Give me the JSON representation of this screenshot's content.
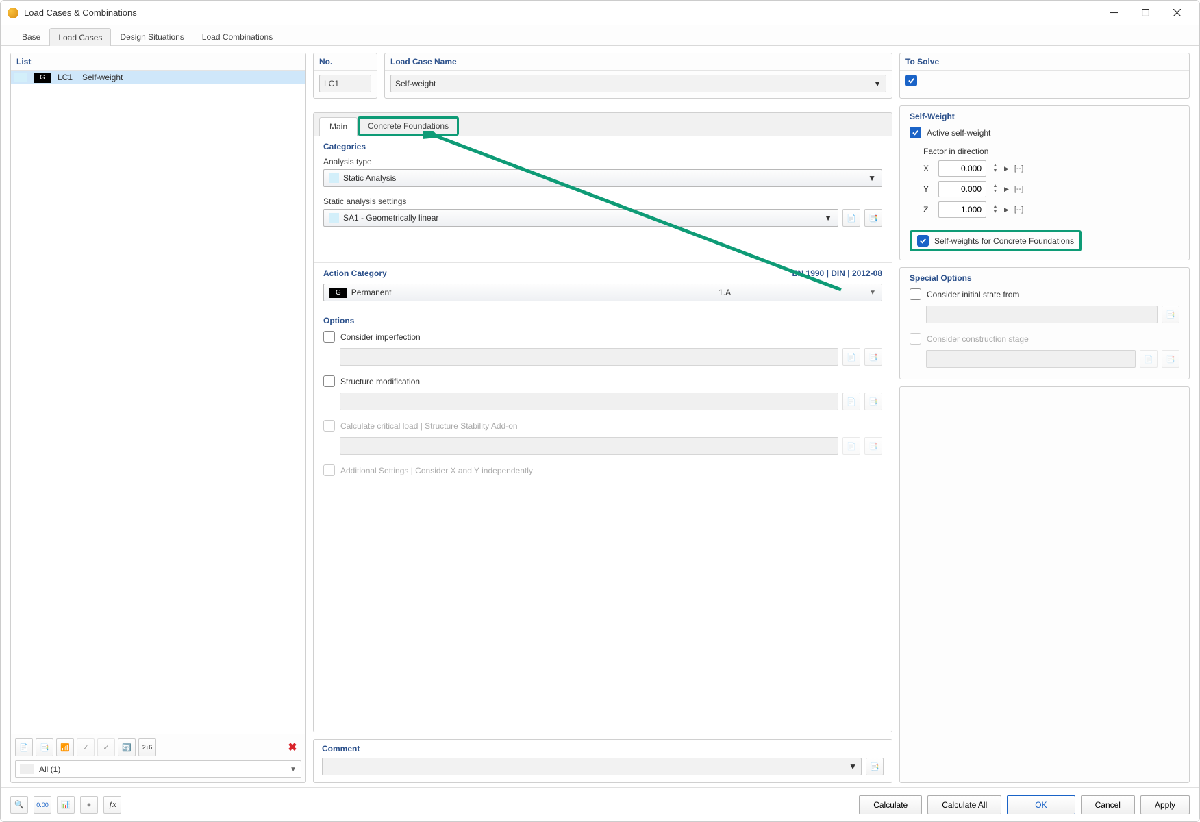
{
  "window": {
    "title": "Load Cases & Combinations"
  },
  "tabs": {
    "base": "Base",
    "loadcases": "Load Cases",
    "design": "Design Situations",
    "combos": "Load Combinations"
  },
  "list": {
    "header": "List",
    "items": [
      {
        "id": "LC1",
        "name": "Self-weight",
        "badge": "G"
      }
    ],
    "filter": "All (1)"
  },
  "fields": {
    "no": {
      "label": "No.",
      "value": "LC1"
    },
    "name": {
      "label": "Load Case Name",
      "value": "Self-weight"
    },
    "solve": {
      "label": "To Solve"
    }
  },
  "subtabs": {
    "main": "Main",
    "cf": "Concrete Foundations"
  },
  "categories": {
    "title": "Categories",
    "analysis_type_label": "Analysis type",
    "analysis_type_value": "Static Analysis",
    "sas_label": "Static analysis settings",
    "sas_value": "SA1 - Geometrically linear"
  },
  "action_category": {
    "title": "Action Category",
    "standard": "EN 1990 | DIN | 2012-08",
    "badge": "G",
    "name": "Permanent",
    "code": "1.A"
  },
  "options": {
    "title": "Options",
    "imperfection": "Consider imperfection",
    "structmod": "Structure modification",
    "critical": "Calculate critical load | Structure Stability Add-on",
    "additional": "Additional Settings | Consider X and Y independently"
  },
  "selfweight": {
    "title": "Self-Weight",
    "active": "Active self-weight",
    "factor_label": "Factor in direction",
    "x": "0.000",
    "y": "0.000",
    "z": "1.000",
    "unit": "[--]",
    "cf_check": "Self-weights for Concrete Foundations"
  },
  "special": {
    "title": "Special Options",
    "initial": "Consider initial state from",
    "construction": "Consider construction stage"
  },
  "comment": {
    "title": "Comment"
  },
  "footer": {
    "calculate": "Calculate",
    "calculate_all": "Calculate All",
    "ok": "OK",
    "cancel": "Cancel",
    "apply": "Apply"
  }
}
